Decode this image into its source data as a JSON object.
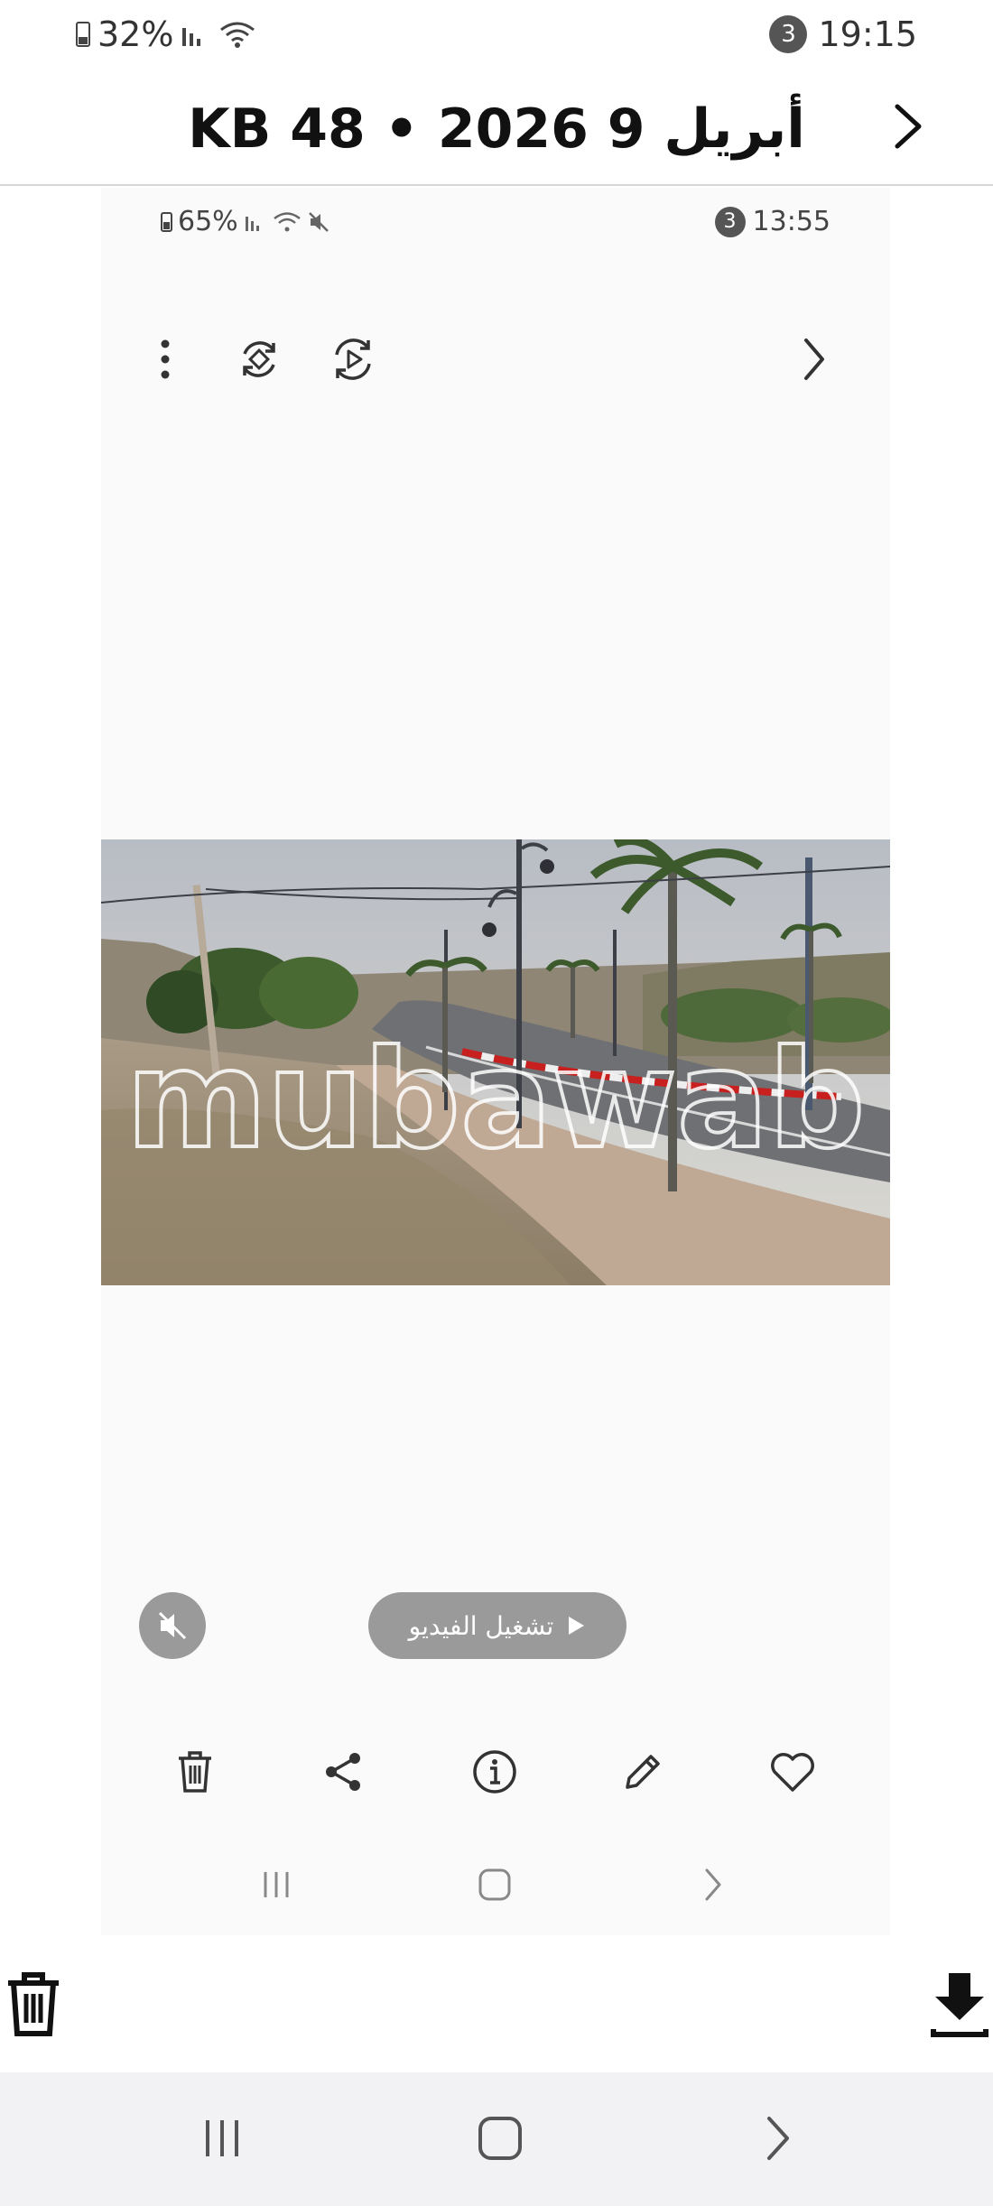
{
  "status_bar": {
    "battery": "32%",
    "notification_count": "3",
    "time": "19:15"
  },
  "header": {
    "title": "KB 48 • 2026 أبريل 9"
  },
  "inner_screenshot": {
    "status_bar": {
      "battery": "65%",
      "notification_count": "3",
      "time": "13:55"
    },
    "toolbar": {
      "icons": [
        "more-vert-icon",
        "rotate-icon",
        "motion-photo-icon",
        "chevron-right-icon"
      ]
    },
    "photo": {
      "watermark": "mubawab"
    },
    "play_button_label": "تشغيل الفيديو",
    "actions": {
      "icons": [
        "delete-icon",
        "share-icon",
        "info-icon",
        "edit-icon",
        "favorite-icon"
      ]
    },
    "nav": {
      "icons": [
        "recents-icon",
        "home-icon",
        "back-icon"
      ]
    }
  },
  "bottom_actions": {
    "icons": [
      "delete-icon",
      "download-icon"
    ]
  },
  "system_nav": {
    "icons": [
      "recents-icon",
      "home-icon",
      "back-icon"
    ]
  },
  "colors": {
    "background": "#ffffff",
    "inner_background": "#fafafa",
    "control_gray": "#9a9a9a",
    "nav_background": "#f2f2f4"
  }
}
